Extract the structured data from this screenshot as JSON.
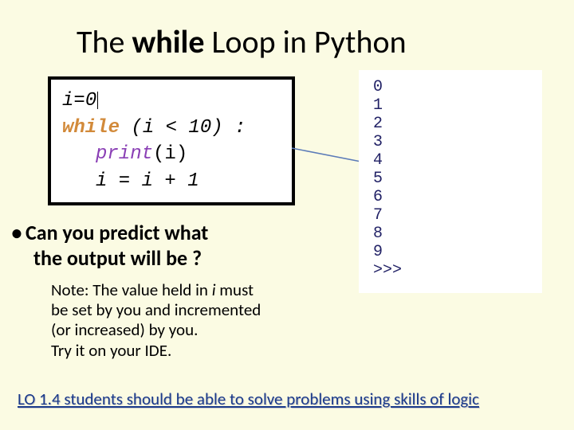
{
  "title_pre": "The ",
  "title_bold": "while",
  "title_post": " Loop in Python",
  "code": {
    "l1_lhs": "i",
    "l1_eq": "=",
    "l1_rhs": "0",
    "l2_kw": "while",
    "l2_cond": " (i < 10) :",
    "l3_fn": "print",
    "l3_arg": "(i)",
    "l4": "i = i + 1"
  },
  "output": [
    "0",
    "1",
    "2",
    "3",
    "4",
    "5",
    "6",
    "7",
    "8",
    "9",
    ">>>"
  ],
  "bullet_line1": "Can you predict what",
  "bullet_line2": "the output will be ?",
  "note_line1a": "Note:  The value held in ",
  "note_line1_i": "i",
  "note_line1b": " must",
  "note_line2": "be set by you and incremented",
  "note_line3": "(or increased) by you.",
  "note_line4": "Try it on your IDE.",
  "footer": "LO 1.4 students should be able to solve problems using skills of logic"
}
